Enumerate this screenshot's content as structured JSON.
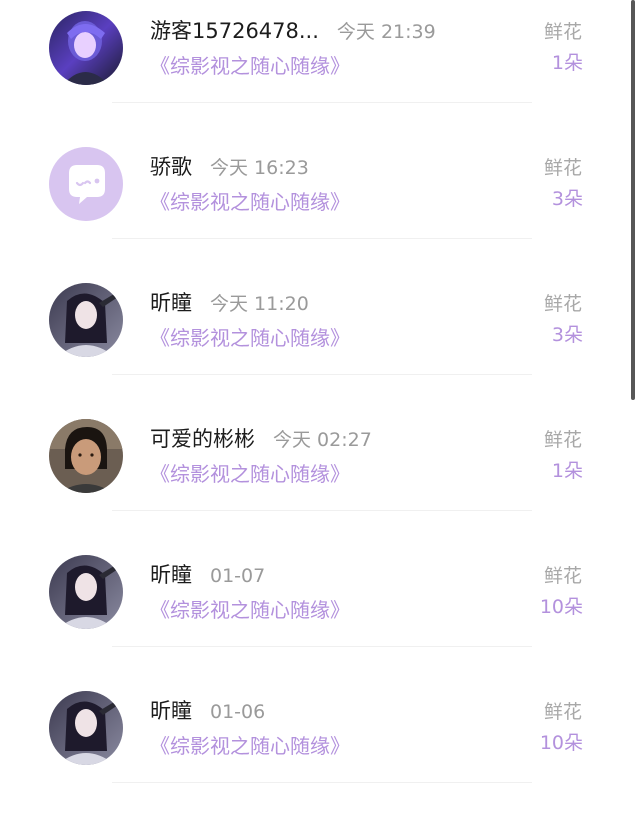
{
  "rows": [
    {
      "username": "游客15726478...",
      "time": "今天 21:39",
      "book": "《综影视之随心随缘》",
      "gift_label": "鲜花",
      "gift_count": "1朵"
    },
    {
      "username": "骄歌",
      "time": "今天 16:23",
      "book": "《综影视之随心随缘》",
      "gift_label": "鲜花",
      "gift_count": "3朵"
    },
    {
      "username": "昕瞳",
      "time": "今天 11:20",
      "book": "《综影视之随心随缘》",
      "gift_label": "鲜花",
      "gift_count": "3朵"
    },
    {
      "username": "可爱的彬彬",
      "time": "今天 02:27",
      "book": "《综影视之随心随缘》",
      "gift_label": "鲜花",
      "gift_count": "1朵"
    },
    {
      "username": "昕瞳",
      "time": "01-07",
      "book": "《综影视之随心随缘》",
      "gift_label": "鲜花",
      "gift_count": "10朵"
    },
    {
      "username": "昕瞳",
      "time": "01-06",
      "book": "《综影视之随心随缘》",
      "gift_label": "鲜花",
      "gift_count": "10朵"
    }
  ],
  "colors": {
    "accent_purple": "#b391dd",
    "avatar_default_bg": "#d8c5f0",
    "divider": "#f0f0f0"
  }
}
